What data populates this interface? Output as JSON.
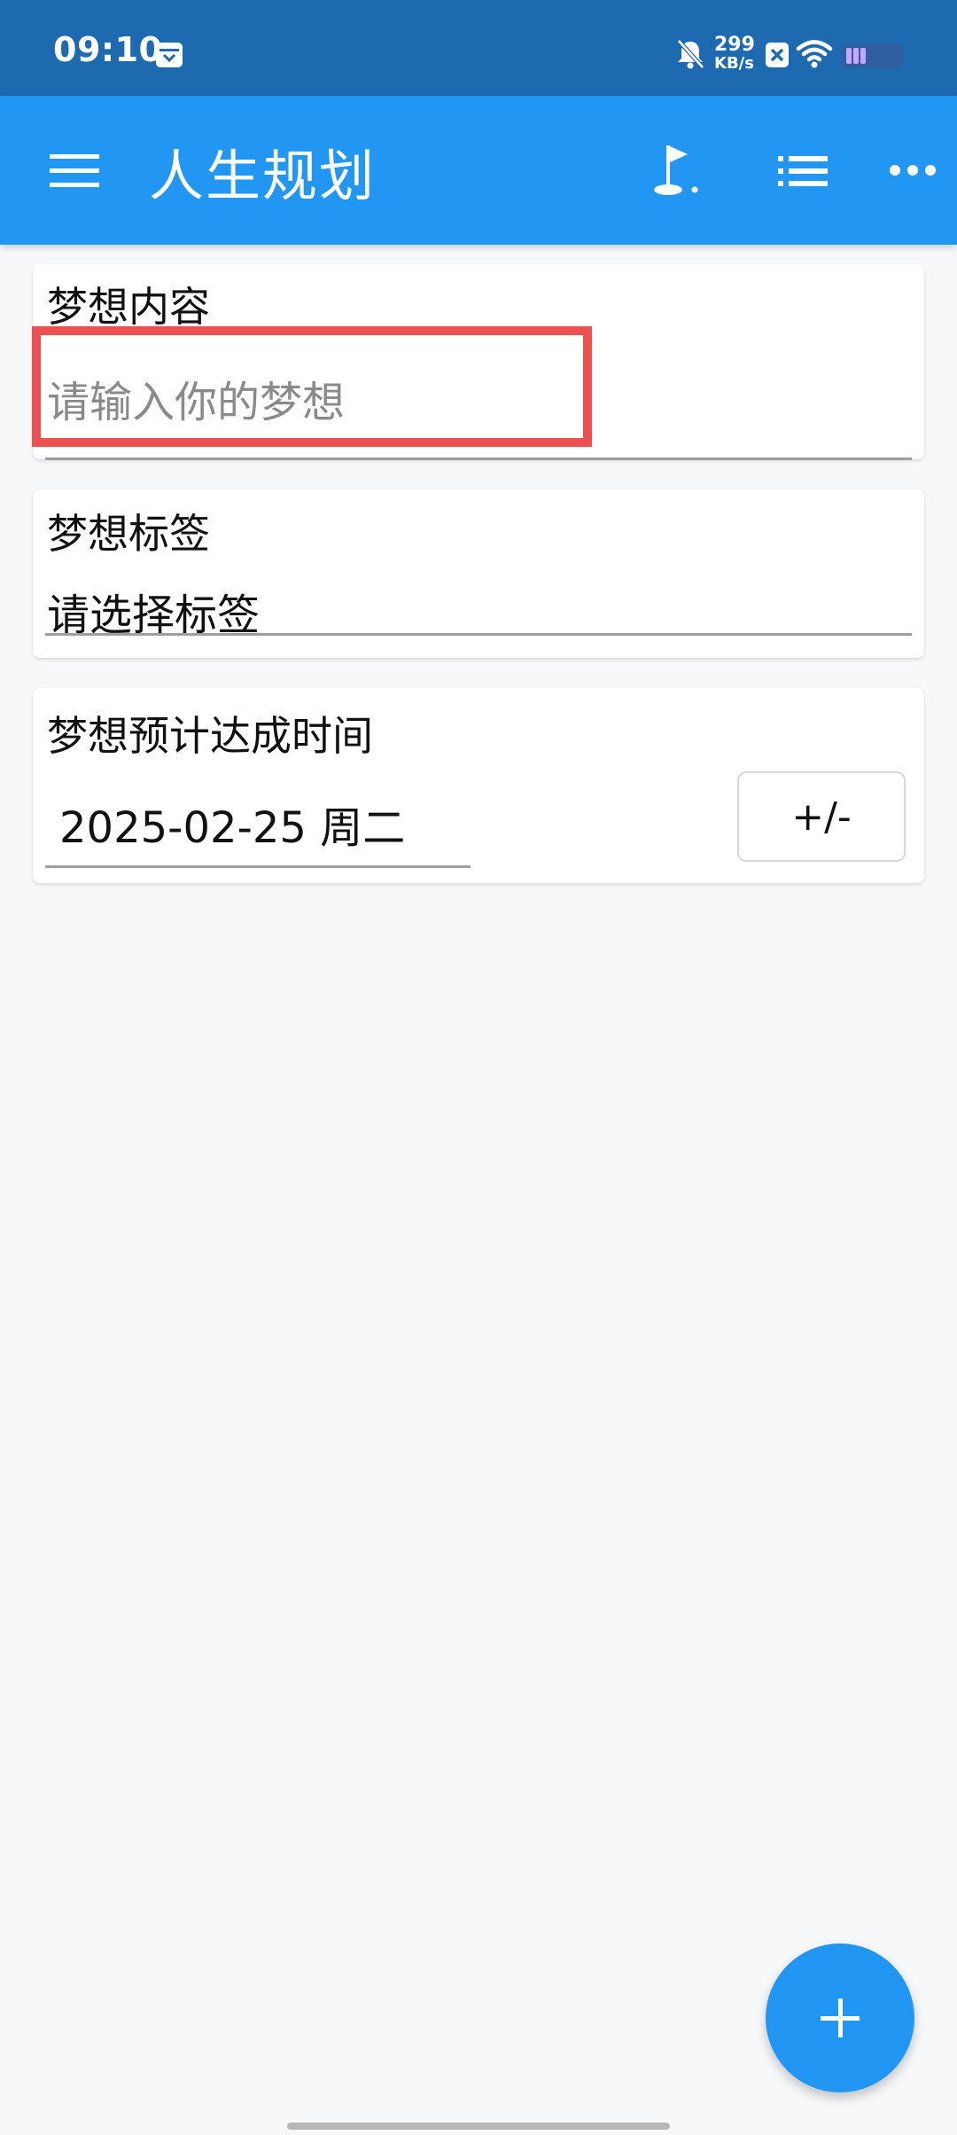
{
  "status_bar": {
    "time": "09:10",
    "net_speed_value": "299",
    "net_speed_unit": "KB/s"
  },
  "app_bar": {
    "title": "人生规划"
  },
  "dream_content": {
    "label": "梦想内容",
    "placeholder": "请输入你的梦想"
  },
  "dream_tag": {
    "label": "梦想标签",
    "value": "请选择标签"
  },
  "dream_date": {
    "label": "梦想预计达成时间",
    "value": "2025-02-25 周二",
    "adjust_label": "+/-"
  },
  "colors": {
    "status_bar": "#1e6ab0",
    "app_bar": "#2196f3",
    "fab": "#2196f3",
    "highlight": "#ec5050"
  }
}
